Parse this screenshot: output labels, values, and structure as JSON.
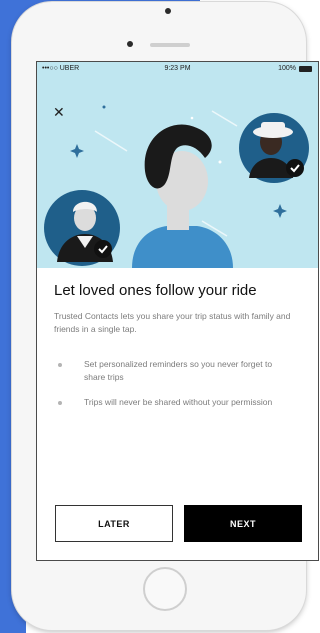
{
  "status_bar": {
    "carrier": "•••○○ UBER",
    "time": "9:23 PM",
    "battery": "100%"
  },
  "onboarding": {
    "title": "Let loved ones follow your ride",
    "description": "Trusted Contacts lets you share your trip status with family and friends in a single tap.",
    "bullets": [
      "Set personalized reminders so you never forget to share trips",
      "Trips will never be shared without your permission"
    ],
    "later_label": "LATER",
    "next_label": "NEXT"
  },
  "colors": {
    "hero_bg": "#bfe6f0",
    "primary_button": "#000000",
    "background_accent": "#3f72d8"
  },
  "icons": {
    "close": "close-icon",
    "checkmark": "checkmark-icon"
  }
}
